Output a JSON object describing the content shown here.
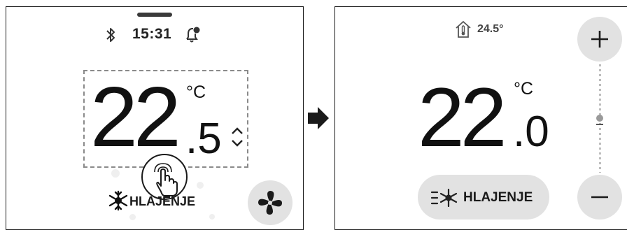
{
  "left_screen": {
    "status": {
      "time": "15:31"
    },
    "setpoint": {
      "integer": "22",
      "decimal": ".5",
      "unit": "°C"
    },
    "mode": {
      "label": "HLAJENJE"
    }
  },
  "right_screen": {
    "indoor_temperature": "24.5°",
    "setpoint": {
      "integer": "22",
      "decimal": ".0",
      "unit": "°C"
    },
    "mode": {
      "label": "HLAJENJE"
    }
  },
  "icons": {
    "status": [
      "bluetooth-icon",
      "bell-icon"
    ],
    "controls": [
      "up-down-icon",
      "tap-hand-icon",
      "snowflake-icon",
      "fan-icon",
      "house-thermometer-icon",
      "plus-icon",
      "minus-icon"
    ],
    "transition": "arrow-right-icon"
  },
  "colors": {
    "button_bg": "#e2e2e2",
    "text": "#111111",
    "dashed_frame": "#8a8a8a"
  }
}
